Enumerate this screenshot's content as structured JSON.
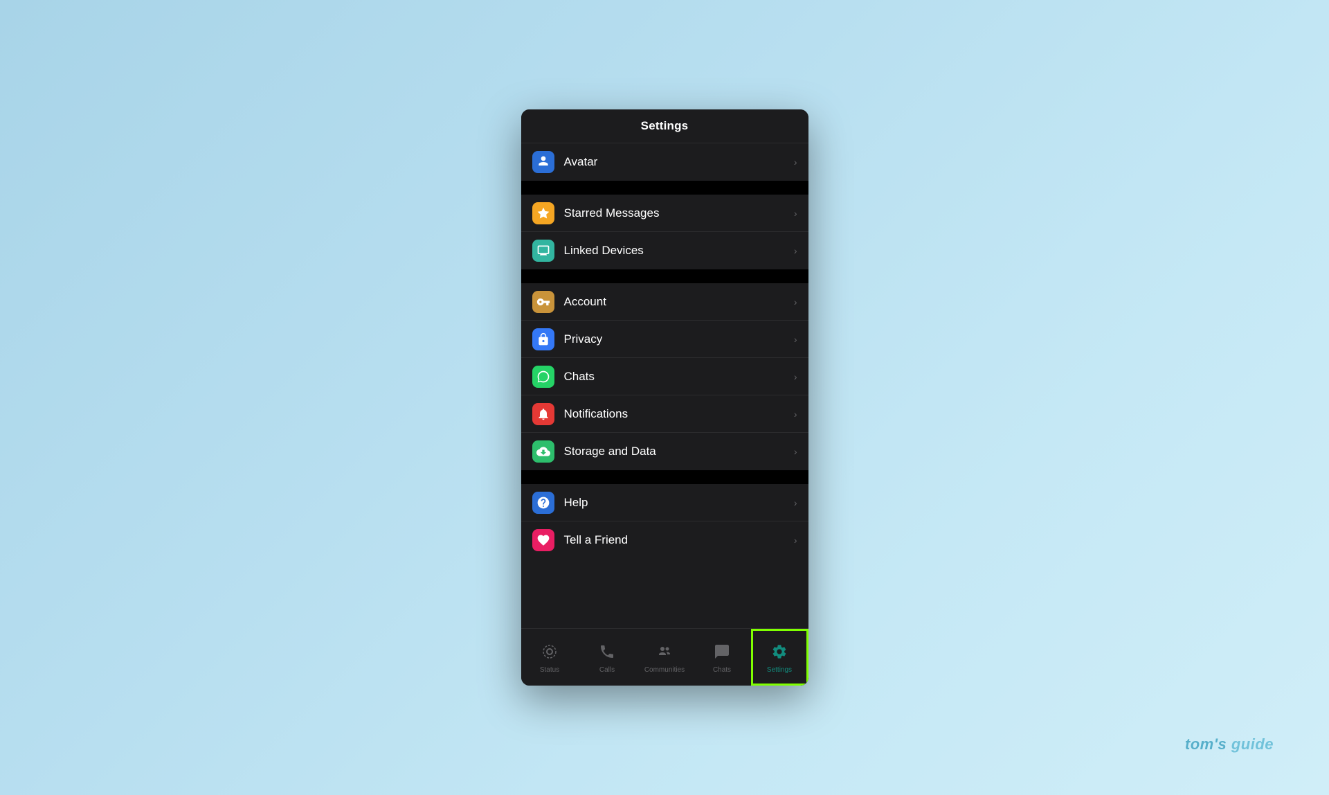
{
  "header": {
    "title": "Settings"
  },
  "sections": [
    {
      "id": "section-avatar",
      "items": [
        {
          "id": "avatar",
          "label": "Avatar",
          "icon": "avatar-icon",
          "iconBg": "icon-blue"
        }
      ]
    },
    {
      "id": "section-starred",
      "items": [
        {
          "id": "starred-messages",
          "label": "Starred Messages",
          "icon": "star-icon",
          "iconBg": "icon-yellow"
        },
        {
          "id": "linked-devices",
          "label": "Linked Devices",
          "icon": "linked-icon",
          "iconBg": "icon-teal"
        }
      ]
    },
    {
      "id": "section-account",
      "items": [
        {
          "id": "account",
          "label": "Account",
          "icon": "key-icon",
          "iconBg": "icon-gold"
        },
        {
          "id": "privacy",
          "label": "Privacy",
          "icon": "privacy-icon",
          "iconBg": "icon-blue-dark"
        },
        {
          "id": "chats",
          "label": "Chats",
          "icon": "chats-icon",
          "iconBg": "icon-green"
        },
        {
          "id": "notifications",
          "label": "Notifications",
          "icon": "notifications-icon",
          "iconBg": "icon-red"
        },
        {
          "id": "storage-data",
          "label": "Storage and Data",
          "icon": "storage-icon",
          "iconBg": "icon-green2"
        }
      ]
    },
    {
      "id": "section-help",
      "items": [
        {
          "id": "help",
          "label": "Help",
          "icon": "help-icon",
          "iconBg": "icon-info-blue"
        },
        {
          "id": "tell-friend",
          "label": "Tell a Friend",
          "icon": "heart-icon",
          "iconBg": "icon-pink"
        }
      ]
    }
  ],
  "tabBar": {
    "items": [
      {
        "id": "tab-status",
        "label": "Status",
        "icon": "status-tab-icon"
      },
      {
        "id": "tab-calls",
        "label": "Calls",
        "icon": "calls-tab-icon"
      },
      {
        "id": "tab-communities",
        "label": "Communities",
        "icon": "communities-tab-icon"
      },
      {
        "id": "tab-chats",
        "label": "Chats",
        "icon": "chats-tab-icon"
      },
      {
        "id": "tab-settings",
        "label": "Settings",
        "icon": "settings-tab-icon",
        "active": true
      }
    ]
  },
  "watermark": {
    "text": "tom's guide"
  }
}
